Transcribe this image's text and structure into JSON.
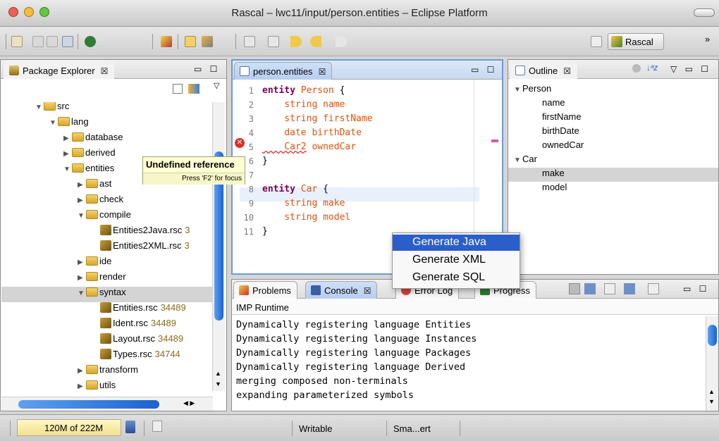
{
  "window": {
    "title": "Rascal – lwc11/input/person.entities – Eclipse Platform"
  },
  "toolbar": {
    "perspective_label": "Rascal",
    "more_label": "»"
  },
  "package_explorer": {
    "tab_label": "Package Explorer",
    "close_glyph": "☒",
    "tree": [
      {
        "label": "src",
        "rev": "",
        "depth": 0,
        "kind": "folder",
        "open": true
      },
      {
        "label": "lang",
        "rev": "",
        "depth": 1,
        "kind": "folder",
        "open": true
      },
      {
        "label": "database",
        "rev": "",
        "depth": 2,
        "kind": "folder",
        "open": false
      },
      {
        "label": "derived",
        "rev": "",
        "depth": 2,
        "kind": "folder",
        "open": false
      },
      {
        "label": "entities",
        "rev": "",
        "depth": 2,
        "kind": "folder",
        "open": true
      },
      {
        "label": "ast",
        "rev": "",
        "depth": 3,
        "kind": "folder",
        "open": false
      },
      {
        "label": "check",
        "rev": "",
        "depth": 3,
        "kind": "folder",
        "open": false
      },
      {
        "label": "compile",
        "rev": "",
        "depth": 3,
        "kind": "folder",
        "open": true
      },
      {
        "label": "Entities2Java.rsc",
        "rev": "3",
        "depth": 4,
        "kind": "file",
        "open": false
      },
      {
        "label": "Entities2XML.rsc",
        "rev": "3",
        "depth": 4,
        "kind": "file",
        "open": false
      },
      {
        "label": "ide",
        "rev": "",
        "depth": 3,
        "kind": "folder",
        "open": false
      },
      {
        "label": "render",
        "rev": "",
        "depth": 3,
        "kind": "folder",
        "open": false
      },
      {
        "label": "syntax",
        "rev": "",
        "depth": 3,
        "kind": "folder",
        "open": true
      },
      {
        "label": "Entities.rsc",
        "rev": "34489",
        "depth": 4,
        "kind": "file",
        "open": false
      },
      {
        "label": "Ident.rsc",
        "rev": "34489",
        "depth": 4,
        "kind": "file",
        "open": false
      },
      {
        "label": "Layout.rsc",
        "rev": "34489",
        "depth": 4,
        "kind": "file",
        "open": false
      },
      {
        "label": "Types.rsc",
        "rev": "34744",
        "depth": 4,
        "kind": "file",
        "open": false
      },
      {
        "label": "transform",
        "rev": "",
        "depth": 3,
        "kind": "folder",
        "open": false
      },
      {
        "label": "utils",
        "rev": "",
        "depth": 3,
        "kind": "folder",
        "open": false
      }
    ]
  },
  "editor": {
    "tab_label": "person.entities",
    "close_glyph": "☒",
    "lines": [
      {
        "n": "1",
        "tokens": [
          {
            "t": "entity ",
            "c": "kw"
          },
          {
            "t": "Person",
            "c": "ty"
          },
          {
            "t": " {",
            "c": "op"
          }
        ]
      },
      {
        "n": "2",
        "tokens": [
          {
            "t": "    string ",
            "c": "ty"
          },
          {
            "t": "name",
            "c": "ty"
          }
        ]
      },
      {
        "n": "3",
        "tokens": [
          {
            "t": "    string ",
            "c": "ty"
          },
          {
            "t": "firstName",
            "c": "ty"
          }
        ]
      },
      {
        "n": "4",
        "tokens": [
          {
            "t": "    date ",
            "c": "ty"
          },
          {
            "t": "birthDate",
            "c": "ty"
          }
        ]
      },
      {
        "n": "5",
        "tokens": [
          {
            "t": "    Car2",
            "c": "ty"
          },
          {
            "t": " ownedCar",
            "c": "ty"
          }
        ]
      },
      {
        "n": "6",
        "tokens": [
          {
            "t": "}",
            "c": "op"
          }
        ]
      },
      {
        "n": "7",
        "tokens": []
      },
      {
        "n": "8",
        "tokens": [
          {
            "t": "entity ",
            "c": "kw"
          },
          {
            "t": "Car",
            "c": "ty"
          },
          {
            "t": " {",
            "c": "op"
          }
        ]
      },
      {
        "n": "9",
        "tokens": [
          {
            "t": "    string ",
            "c": "ty"
          },
          {
            "t": "make",
            "c": "ty"
          }
        ]
      },
      {
        "n": "10",
        "tokens": [
          {
            "t": "    string ",
            "c": "ty"
          },
          {
            "t": "model",
            "c": "ty"
          }
        ]
      },
      {
        "n": "11",
        "tokens": [
          {
            "t": "}",
            "c": "op"
          }
        ]
      }
    ]
  },
  "tooltip": {
    "title": "Undefined reference",
    "hint": "Press 'F2' for focus"
  },
  "outline": {
    "tab_label": "Outline",
    "close_glyph": "☒",
    "items": [
      {
        "label": "Person",
        "depth": 0,
        "open": true
      },
      {
        "label": "name",
        "depth": 1,
        "open": false
      },
      {
        "label": "firstName",
        "depth": 1,
        "open": false
      },
      {
        "label": "birthDate",
        "depth": 1,
        "open": false
      },
      {
        "label": "ownedCar",
        "depth": 1,
        "open": false
      },
      {
        "label": "Car",
        "depth": 0,
        "open": true
      },
      {
        "label": "make",
        "depth": 1,
        "open": false
      },
      {
        "label": "model",
        "depth": 1,
        "open": false
      }
    ]
  },
  "context_menu": {
    "items": [
      "Generate Java",
      "Generate XML",
      "Generate SQL"
    ]
  },
  "console": {
    "tabs": {
      "problems": "Problems",
      "console": "Console",
      "close_glyph": "☒",
      "error_log": "Error Log",
      "progress": "Progress"
    },
    "header": "IMP Runtime",
    "lines": [
      "Dynamically registering language Entities",
      "Dynamically registering language Instances",
      "Dynamically registering language Packages",
      "Dynamically registering language Derived",
      "merging composed non-terminals",
      "expanding parameterized symbols"
    ]
  },
  "statusbar": {
    "heap": "120M of 222M",
    "writable": "Writable",
    "insert_mode": "Sma...ert"
  },
  "colors": {
    "selection_row": "#d4d4d4",
    "highlight_line": "#e8f0fb",
    "menu_selected": "#2a5ec8",
    "error_marker": "#d8322a"
  }
}
